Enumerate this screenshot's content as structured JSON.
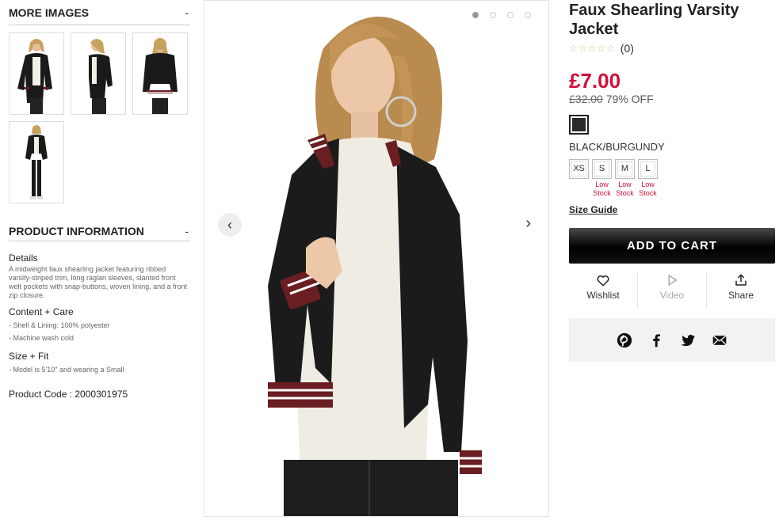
{
  "more_images": {
    "heading": "MORE IMAGES",
    "toggle": "-"
  },
  "product_info": {
    "heading": "PRODUCT INFORMATION",
    "toggle": "-",
    "details_title": "Details",
    "details_text": "A midweight faux shearling jacket featuring ribbed varsity-striped trim, long raglan sleeves, slanted front welt pockets with snap-buttons, woven lining, and a front zip closure.",
    "care_title": "Content + Care",
    "care_items": [
      "- Shell & Lining: 100% polyester",
      "- Machine wash cold"
    ],
    "fit_title": "Size + Fit",
    "fit_items": [
      "- Model is 5'10\" and wearing a Small"
    ],
    "code": "Product Code : 2000301975"
  },
  "product": {
    "title": "Faux Shearling Varsity Jacket",
    "stars": "☆☆☆☆☆",
    "review_count": "(0)",
    "price": "£7.00",
    "original_price": "£32.00",
    "discount": "79% OFF",
    "color_name": "BLACK/BURGUNDY",
    "sizes": [
      {
        "label": "XS",
        "stock": ""
      },
      {
        "label": "S",
        "stock": "Low Stock"
      },
      {
        "label": "M",
        "stock": "Low Stock"
      },
      {
        "label": "L",
        "stock": "Low Stock"
      }
    ],
    "size_guide": "Size Guide",
    "add_to_cart": "ADD TO CART"
  },
  "actions": {
    "wishlist": "Wishlist",
    "video": "Video",
    "share": "Share"
  },
  "social": [
    "pinterest-icon",
    "facebook-icon",
    "twitter-icon",
    "email-icon"
  ],
  "colors": {
    "price_red": "#d0103a",
    "swatch": "#2a2a2a",
    "jacket": "#1a1a1a",
    "trim": "#6b1e22"
  }
}
